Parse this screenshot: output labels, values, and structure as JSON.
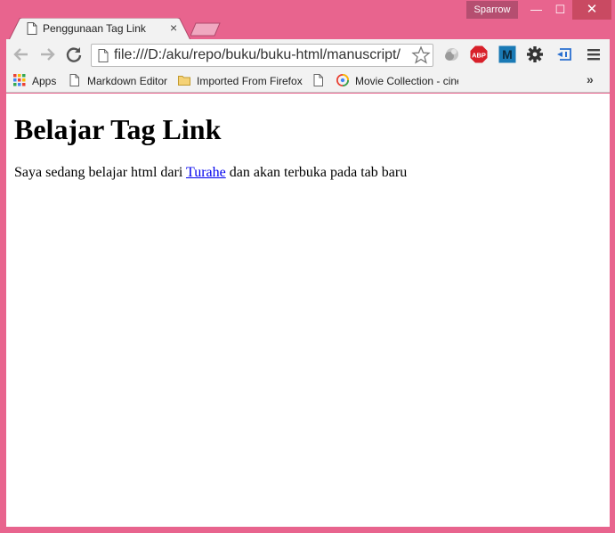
{
  "window": {
    "profile_name": "Sparrow",
    "minimize": "—",
    "maximize": "☐",
    "close": "✕",
    "frame_color": "#e8648e"
  },
  "tab": {
    "title": "Penggunaan Tag Link",
    "close": "×"
  },
  "toolbar": {
    "url": "file:///D:/aku/repo/buku/buku-html/manuscript/",
    "extensions": [
      "extension-icon",
      "adblock-plus-icon",
      "m-extension-icon",
      "gear-icon",
      "cast-icon"
    ],
    "abp_label": "ABP",
    "m_label": "M"
  },
  "bookmarks": {
    "items": [
      {
        "label": "Apps",
        "icon": "apps-grid-icon"
      },
      {
        "label": "Markdown Editor",
        "icon": "page-icon"
      },
      {
        "label": "Imported From Firefox",
        "icon": "folder-icon"
      },
      {
        "label": "",
        "icon": "page-icon"
      },
      {
        "label": "Movie Collection - cinema",
        "icon": "movie-icon"
      }
    ],
    "more": "»"
  },
  "page": {
    "heading": "Belajar Tag Link",
    "text_before": "Saya sedang belajar html dari ",
    "link_text": "Turahe",
    "text_after": " dan akan terbuka pada tab baru",
    "link_color": "#0000ee"
  }
}
